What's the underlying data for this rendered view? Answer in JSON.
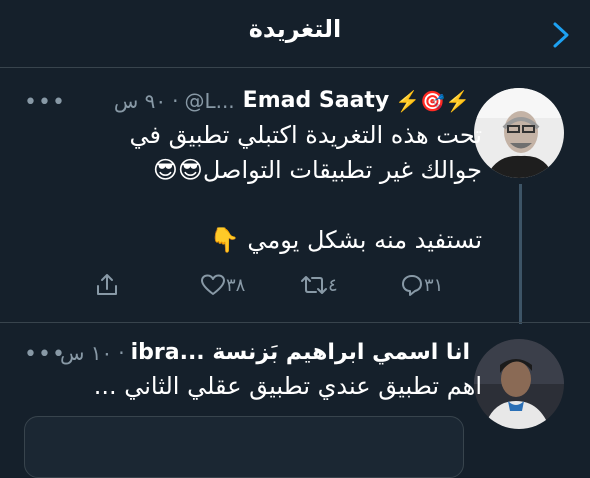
{
  "header": {
    "title": "التغريدة",
    "back_icon": "chevron-right-icon",
    "accent": "#1da1f2"
  },
  "tweets": [
    {
      "author_name": "Emad Saaty",
      "author_emoji": "⚡️🎯⚡️",
      "handle": "@L...",
      "time": "٩٠ س",
      "more": "•••",
      "body_lines": [
        "تحت هذه التغريدة اكتبلي تطبيق في",
        "جوالك  غير تطبيقات التواصل😎😎",
        "تستفيد منه بشكل يومي 👇"
      ],
      "actions": {
        "reply_count": "٣١",
        "retweet_count": "٤",
        "like_count": "٣٨",
        "share_icon": "share-icon"
      }
    },
    {
      "author_name": "انا اسمي ابراهيم بَزنسة ...ibra",
      "time": "١٠ س",
      "more": "•••",
      "body_lines": [
        "اهم تطبيق عندي تطبيق عقلي الثاني ..."
      ]
    }
  ],
  "colors": {
    "background": "#15202b",
    "secondary_text": "#8899a6",
    "divider": "#38444d"
  }
}
